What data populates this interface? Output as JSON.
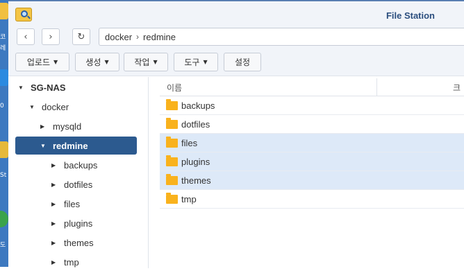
{
  "window": {
    "title": "File Station"
  },
  "nav": {
    "back_icon": "‹",
    "forward_icon": "›",
    "refresh_icon": "↻",
    "path": [
      "docker",
      "redmine"
    ],
    "separator": "›"
  },
  "toolbar": {
    "upload": "업로드",
    "create": "생성",
    "action": "작업",
    "tools": "도구",
    "settings": "설정"
  },
  "tree": {
    "root": "SG-NAS",
    "docker": "docker",
    "mysqld": "mysqld",
    "redmine": "redmine",
    "children": [
      "backups",
      "dotfiles",
      "files",
      "plugins",
      "themes",
      "tmp"
    ]
  },
  "list": {
    "columns": {
      "name": "이름",
      "size": "크"
    },
    "files": [
      {
        "name": "backups",
        "selected": false
      },
      {
        "name": "dotfiles",
        "selected": false
      },
      {
        "name": "files",
        "selected": true
      },
      {
        "name": "plugins",
        "selected": true
      },
      {
        "name": "themes",
        "selected": true
      },
      {
        "name": "tmp",
        "selected": false
      }
    ]
  },
  "desktop": {
    "labels": [
      "코",
      "레",
      "0",
      "St",
      "도"
    ]
  },
  "colors": {
    "selected_tree": "#2c5a8f",
    "selected_row": "#dde9f8",
    "folder": "#f9b21d",
    "title": "#2b4e7e"
  }
}
